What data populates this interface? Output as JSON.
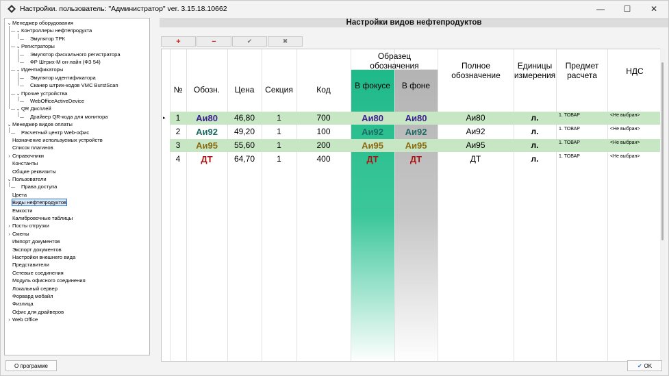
{
  "window": {
    "title": "Настройки. пользователь: \"Администратор\" ver. 3.15.18.10662"
  },
  "tree": [
    {
      "label": "Менеджер оборудования",
      "level": 0,
      "expanded": true
    },
    {
      "label": "Контроллеры нефтепродукта",
      "level": 1,
      "expanded": true
    },
    {
      "label": "Эмулятор ТРК",
      "level": 2
    },
    {
      "label": "Регистраторы",
      "level": 1,
      "expanded": true
    },
    {
      "label": "Эмулятор фискального регистратора",
      "level": 2
    },
    {
      "label": "ФР Штрих-М он-лайн (ФЗ 54)",
      "level": 2
    },
    {
      "label": "Идентификаторы",
      "level": 1,
      "expanded": true
    },
    {
      "label": "Эмулятор идентификатора",
      "level": 2
    },
    {
      "label": "Сканер штрих-кодов VMC BurstScan",
      "level": 2
    },
    {
      "label": "Прочие устройства",
      "level": 1,
      "expanded": true
    },
    {
      "label": "WebOfficeActiveDevice",
      "level": 2
    },
    {
      "label": "QR Дисплей",
      "level": 1,
      "expanded": true
    },
    {
      "label": "Драйвер QR-кода для монитора",
      "level": 2
    },
    {
      "label": "Менеджер видов оплаты",
      "level": 0,
      "expanded": true
    },
    {
      "label": "Расчетный центр Web-офис",
      "level": 1
    },
    {
      "label": "Назначение используемых устройств",
      "level": 0
    },
    {
      "label": "Список плагинов",
      "level": 0
    },
    {
      "label": "Справочники",
      "level": 0,
      "collapsed": true
    },
    {
      "label": "Константы",
      "level": 0
    },
    {
      "label": "Общие реквизиты",
      "level": 0
    },
    {
      "label": "Пользователи",
      "level": 0,
      "expanded": true
    },
    {
      "label": "Права доступа",
      "level": 1
    },
    {
      "label": "Цвета",
      "level": 0
    },
    {
      "label": "Виды нефтепродуктов",
      "level": 0,
      "selected": true
    },
    {
      "label": "Емкости",
      "level": 0
    },
    {
      "label": "Калибровочные таблицы",
      "level": 0
    },
    {
      "label": "Посты отгрузки",
      "level": 0,
      "collapsed": true
    },
    {
      "label": "Смены",
      "level": 0,
      "collapsed": true
    },
    {
      "label": "Импорт документов",
      "level": 0
    },
    {
      "label": "Экспорт документов",
      "level": 0
    },
    {
      "label": "Настройки внешнего вида",
      "level": 0
    },
    {
      "label": "Представители",
      "level": 0
    },
    {
      "label": "Сетевые соединения",
      "level": 0
    },
    {
      "label": "Модуль офисного соединения",
      "level": 0
    },
    {
      "label": "Локальный сервер",
      "level": 0
    },
    {
      "label": "Форвард мобайл",
      "level": 0
    },
    {
      "label": "Физлица",
      "level": 0
    },
    {
      "label": "Офис для драйверов",
      "level": 0
    },
    {
      "label": "Web Office",
      "level": 0,
      "collapsed": true
    }
  ],
  "panel": {
    "title": "Настройки видов нефтепродуктов"
  },
  "toolbar": {
    "add": "+",
    "remove": "−",
    "apply": "✔",
    "cancel": "✖"
  },
  "headers": {
    "num": "№",
    "short": "Обозн.",
    "price": "Цена",
    "section": "Секция",
    "code": "Код",
    "sample": "Образец обозначения",
    "in_focus": "В фокусе",
    "in_bg": "В фоне",
    "full": "Полное обозначение",
    "units": "Единицы измерения",
    "subject": "Предмет расчета",
    "vat": "НДС"
  },
  "rows": [
    {
      "num": "1",
      "short": "Аи80",
      "price": "46,80",
      "section": "1",
      "code": "700",
      "focus": "Аи80",
      "bg": "Аи80",
      "full": "Аи80",
      "units": "л.",
      "subject": "1. ТОВАР",
      "vat": "<Не выбран>",
      "color": "#3a1f8c",
      "highlight": true,
      "current": true
    },
    {
      "num": "2",
      "short": "Аи92",
      "price": "49,20",
      "section": "1",
      "code": "100",
      "focus": "Аи92",
      "bg": "Аи92",
      "full": "Аи92",
      "units": "л.",
      "subject": "1. ТОВАР",
      "vat": "<Не выбран>",
      "color": "#1d6b63",
      "highlight": false
    },
    {
      "num": "3",
      "short": "Аи95",
      "price": "55,60",
      "section": "1",
      "code": "200",
      "focus": "Аи95",
      "bg": "Аи95",
      "full": "Аи95",
      "units": "л.",
      "subject": "1. ТОВАР",
      "vat": "<Не выбран>",
      "color": "#8b6a10",
      "highlight": true
    },
    {
      "num": "4",
      "short": "ДТ",
      "price": "64,70",
      "section": "1",
      "code": "400",
      "focus": "ДТ",
      "bg": "ДТ",
      "full": "ДТ",
      "units": "л.",
      "subject": "1. ТОВАР",
      "vat": "<Не выбран>",
      "color": "#b01212",
      "highlight": false
    }
  ],
  "colors": {
    "highlight_row": "#c6e6c4",
    "accent_red": "#d7281f"
  },
  "bottom": {
    "about": "О программе",
    "ok": "OK"
  }
}
